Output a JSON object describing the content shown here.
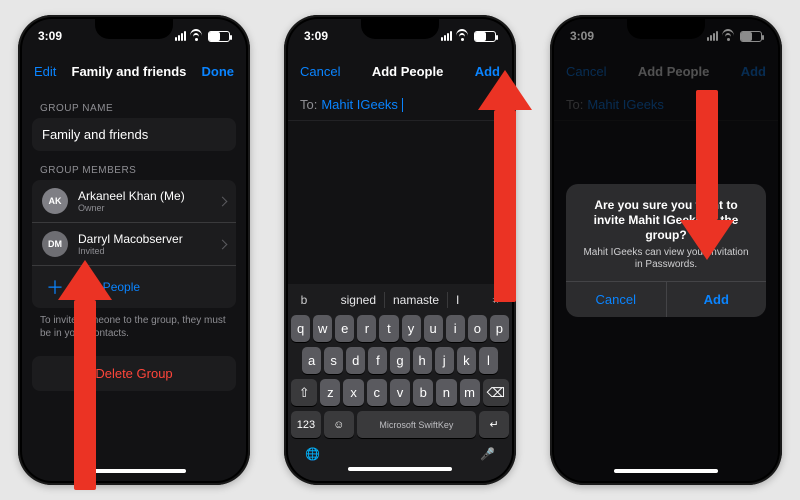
{
  "statusbar": {
    "time": "3:09"
  },
  "phone1": {
    "nav": {
      "left": "Edit",
      "title": "Family and friends",
      "right": "Done"
    },
    "group_name_section": "GROUP NAME",
    "group_name_value": "Family and friends",
    "members_section": "GROUP MEMBERS",
    "members": [
      {
        "initials": "AK",
        "name": "Arkaneel Khan (Me)",
        "sub": "Owner",
        "avatar_color": "#7f7f85"
      },
      {
        "initials": "DM",
        "name": "Darryl Macobserver",
        "sub": "Invited",
        "avatar_color": "#6e6e73"
      }
    ],
    "add_people": "Add People",
    "hint": "To invite someone to the group, they must be in your Contacts.",
    "delete": "Delete Group"
  },
  "phone2": {
    "nav": {
      "left": "Cancel",
      "title": "Add People",
      "right": "Add"
    },
    "to_label": "To:",
    "to_token": "Mahit IGeeks",
    "keyboard": {
      "suggestions": [
        "signed",
        "namaste",
        "I"
      ],
      "row1": [
        "q",
        "w",
        "e",
        "r",
        "t",
        "y",
        "u",
        "i",
        "o",
        "p"
      ],
      "row2": [
        "a",
        "s",
        "d",
        "f",
        "g",
        "h",
        "j",
        "k",
        "l"
      ],
      "row3": [
        "z",
        "x",
        "c",
        "v",
        "b",
        "n",
        "m"
      ],
      "shift": "⇧",
      "backspace": "⌫",
      "numkey": "123",
      "space": "Microsoft SwiftKey",
      "emoji": "☺",
      "return": "↵",
      "globe": "🌐",
      "mic": "🎤"
    }
  },
  "phone3": {
    "nav": {
      "left": "Cancel",
      "title": "Add People",
      "right": "Add"
    },
    "to_label": "To:",
    "to_token": "Mahit IGeeks",
    "alert": {
      "title": "Are you sure you want to invite Mahit IGeeks to the group?",
      "message": "Mahit IGeeks can view your invitation in Passwords.",
      "cancel": "Cancel",
      "add": "Add"
    }
  }
}
